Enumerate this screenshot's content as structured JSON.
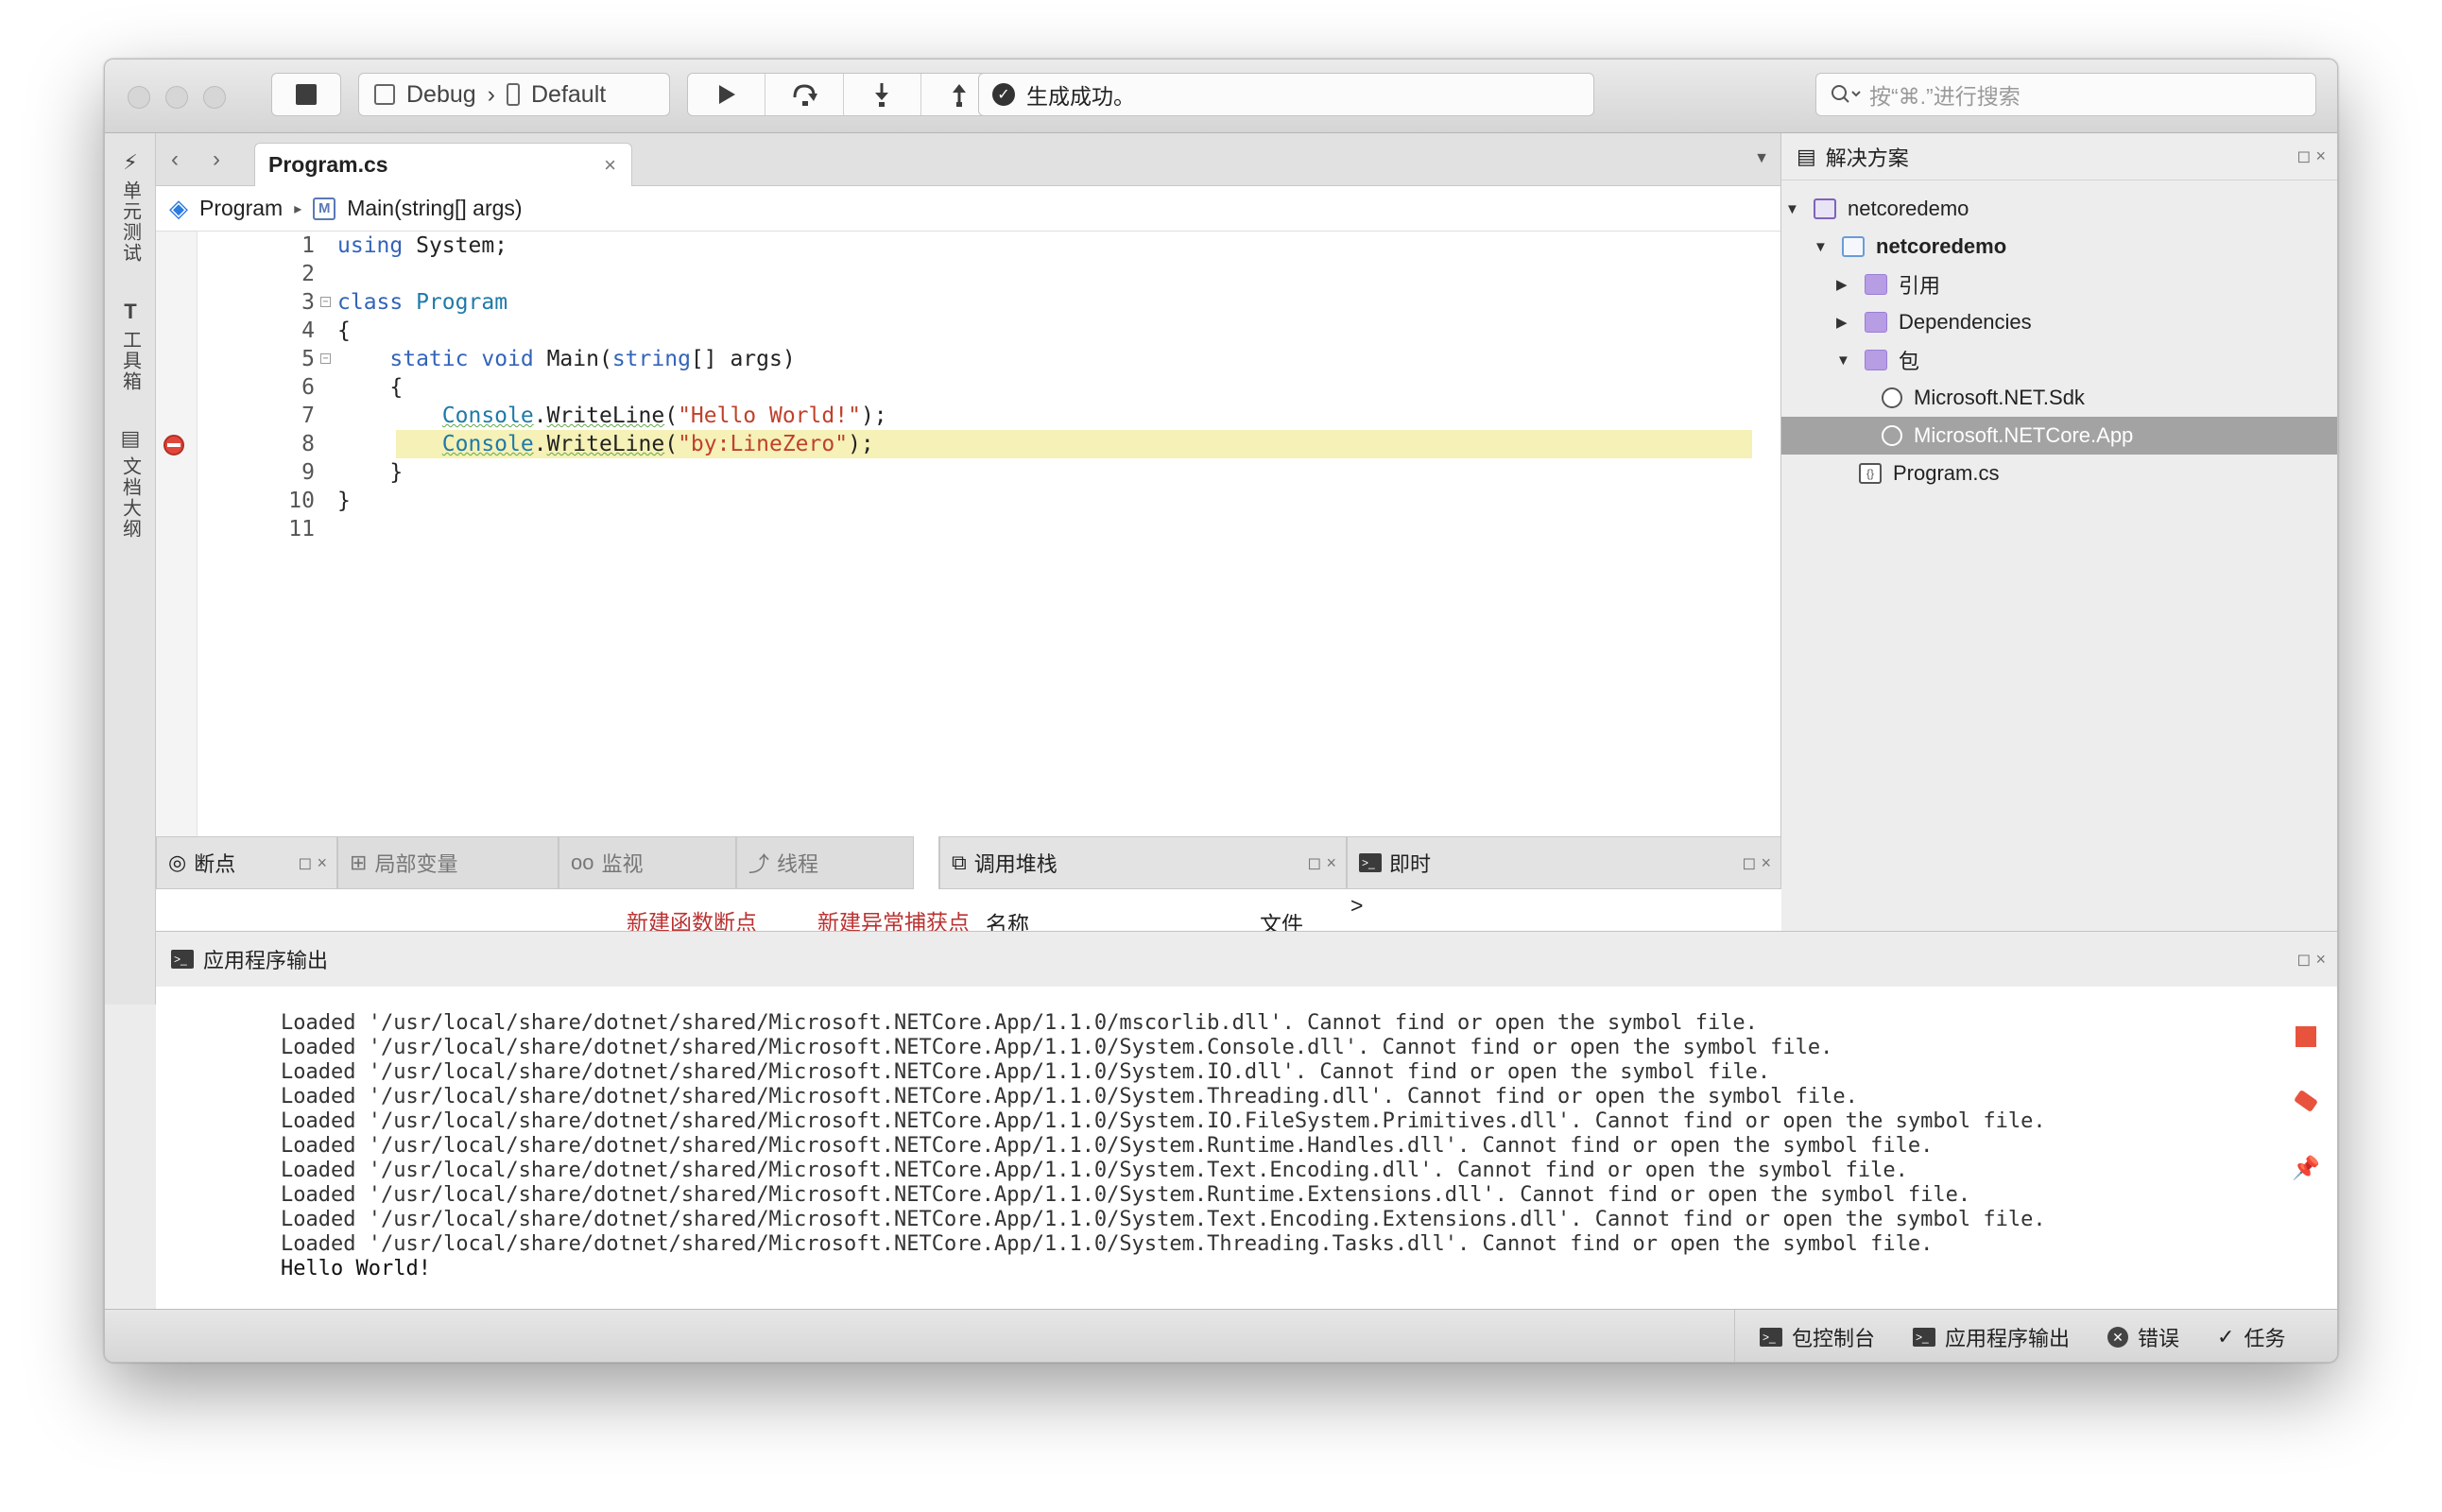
{
  "toolbar": {
    "configuration": "Debug",
    "config_sep": "›",
    "device": "Default",
    "status_text": "生成成功。",
    "search_placeholder": "按“⌘.”进行搜索"
  },
  "left_strip": [
    {
      "icon": "lightning-icon",
      "glyph": "⚡",
      "label": "单元测试"
    },
    {
      "icon": "toolbox-icon",
      "glyph": "T",
      "label": "工具箱"
    },
    {
      "icon": "outline-icon",
      "glyph": "▤",
      "label": "文档大纲"
    }
  ],
  "editor": {
    "tab_title": "Program.cs",
    "tab_close": "×",
    "breadcrumb_class": "Program",
    "breadcrumb_sep": "▸",
    "breadcrumb_method": "Main(string[] args)",
    "breakpoint_line": 8,
    "lines": [
      {
        "n": "1",
        "text": "using System;"
      },
      {
        "n": "2",
        "text": ""
      },
      {
        "n": "3",
        "text": "class Program"
      },
      {
        "n": "4",
        "text": "{"
      },
      {
        "n": "5",
        "text": "    static void Main(string[] args)"
      },
      {
        "n": "6",
        "text": "    {"
      },
      {
        "n": "7",
        "text": "        Console.WriteLine(\"Hello World!\");"
      },
      {
        "n": "8",
        "text": "        Console.WriteLine(\"by:LineZero\");"
      },
      {
        "n": "9",
        "text": "    }"
      },
      {
        "n": "10",
        "text": "}"
      },
      {
        "n": "11",
        "text": ""
      }
    ]
  },
  "debug_pads": {
    "breakpoints": "断点",
    "locals": "局部变量",
    "watch": "监视",
    "threads": "线程",
    "new_func_bp": "新建函数断点",
    "new_exc_bp": "新建异常捕获点",
    "call_stack": "调用堆栈",
    "col_name": "名称",
    "col_file": "文件",
    "immediate": "即时",
    "immediate_prompt": ">"
  },
  "solution": {
    "title": "解决方案",
    "items": [
      {
        "label": "netcoredemo",
        "depth": 0,
        "toggle": "▼",
        "icon": "solution-icon",
        "bold": false
      },
      {
        "label": "netcoredemo",
        "depth": 1,
        "toggle": "▼",
        "icon": "project-icon",
        "bold": true
      },
      {
        "label": "引用",
        "depth": 2,
        "toggle": "▶",
        "icon": "folder-icon",
        "bold": false
      },
      {
        "label": "Dependencies",
        "depth": 2,
        "toggle": "▶",
        "icon": "folder-icon",
        "bold": false
      },
      {
        "label": "包",
        "depth": 2,
        "toggle": "▼",
        "icon": "folder-icon",
        "bold": false
      },
      {
        "label": "Microsoft.NET.Sdk",
        "depth": 3,
        "toggle": "",
        "icon": "package-icon",
        "bold": false
      },
      {
        "label": "Microsoft.NETCore.App",
        "depth": 3,
        "toggle": "",
        "icon": "package-icon",
        "bold": false,
        "selected": true
      },
      {
        "label": "Program.cs",
        "depth": 2,
        "toggle": "",
        "icon": "csharp-file-icon",
        "bold": false
      }
    ]
  },
  "output": {
    "title": "应用程序输出",
    "lines": [
      "Loaded '/usr/local/share/dotnet/shared/Microsoft.NETCore.App/1.1.0/mscorlib.dll'. Cannot find or open the symbol file.",
      "Loaded '/usr/local/share/dotnet/shared/Microsoft.NETCore.App/1.1.0/System.Console.dll'. Cannot find or open the symbol file.",
      "Loaded '/usr/local/share/dotnet/shared/Microsoft.NETCore.App/1.1.0/System.IO.dll'. Cannot find or open the symbol file.",
      "Loaded '/usr/local/share/dotnet/shared/Microsoft.NETCore.App/1.1.0/System.Threading.dll'. Cannot find or open the symbol file.",
      "Loaded '/usr/local/share/dotnet/shared/Microsoft.NETCore.App/1.1.0/System.IO.FileSystem.Primitives.dll'. Cannot find or open the symbol file.",
      "Loaded '/usr/local/share/dotnet/shared/Microsoft.NETCore.App/1.1.0/System.Runtime.Handles.dll'. Cannot find or open the symbol file.",
      "Loaded '/usr/local/share/dotnet/shared/Microsoft.NETCore.App/1.1.0/System.Text.Encoding.dll'. Cannot find or open the symbol file.",
      "Loaded '/usr/local/share/dotnet/shared/Microsoft.NETCore.App/1.1.0/System.Runtime.Extensions.dll'. Cannot find or open the symbol file.",
      "Loaded '/usr/local/share/dotnet/shared/Microsoft.NETCore.App/1.1.0/System.Text.Encoding.Extensions.dll'. Cannot find or open the symbol file.",
      "Loaded '/usr/local/share/dotnet/shared/Microsoft.NETCore.App/1.1.0/System.Threading.Tasks.dll'. Cannot find or open the symbol file.",
      "Hello World!"
    ]
  },
  "statusbar": {
    "package_console": "包控制台",
    "app_output": "应用程序输出",
    "errors": "错误",
    "tasks": "任务"
  },
  "colors": {
    "breakpoint": "#e2463a",
    "current_line": "#f5f1b7",
    "keyword": "#3364b8",
    "string": "#c0412b",
    "selection": "#a3a3a3",
    "folder": "#b69de4"
  }
}
